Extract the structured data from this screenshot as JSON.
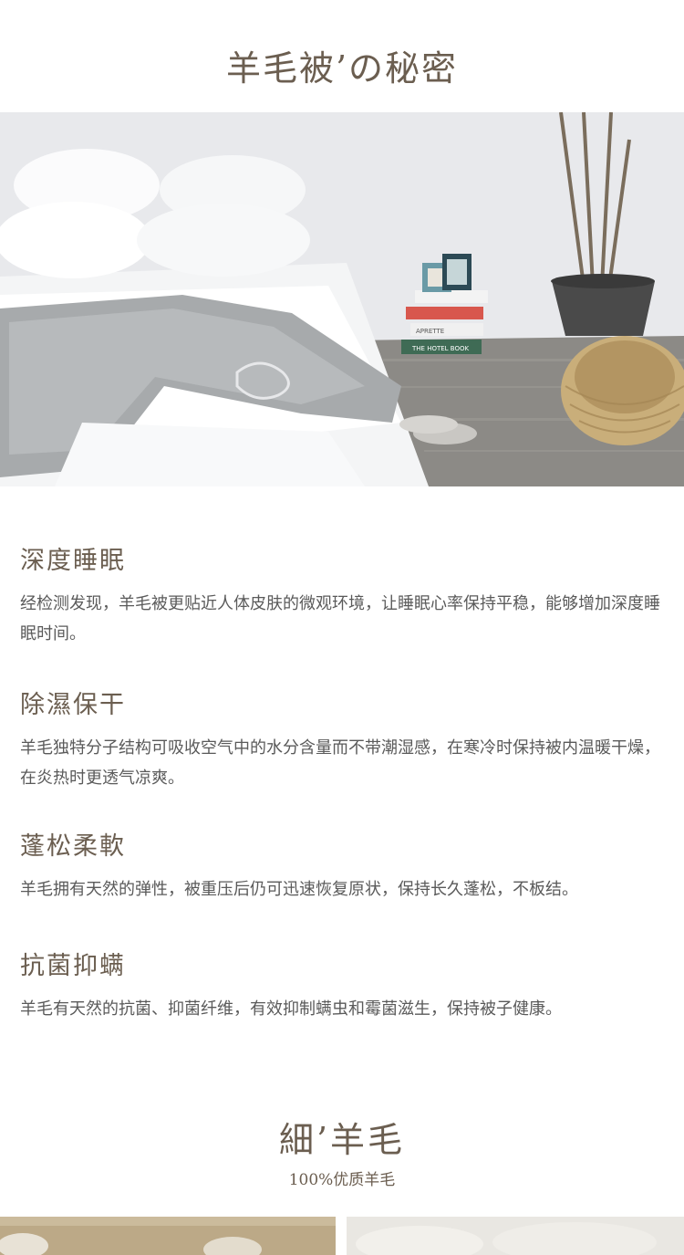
{
  "header": {
    "title": "羊毛被’の秘密"
  },
  "hero": {
    "book_spine_1": "THE HOTEL BOOK",
    "book_spine_2": "APRETTE"
  },
  "features": [
    {
      "heading": "深度睡眠",
      "text": "经检测发现，羊毛被更贴近人体皮肤的微观环境，让睡眠心率保持平稳，能够增加深度睡眠时间。"
    },
    {
      "heading": "除濕保干",
      "text": "羊毛独特分子结构可吸收空气中的水分含量而不带潮湿感，在寒冷时保持被内温暖干燥，在炎热时更透气凉爽。"
    },
    {
      "heading": "蓬松柔軟",
      "text": "羊毛拥有天然的弹性，被重压后仍可迅速恢复原状，保持长久蓬松，不板结。"
    },
    {
      "heading": "抗菌抑螨",
      "text": "羊毛有天然的抗菌、抑菌纤维，有效抑制螨虫和霉菌滋生，保持被子健康。"
    }
  ],
  "footer_section": {
    "title": "細’羊毛",
    "subtitle": "100%优质羊毛"
  },
  "colors": {
    "heading": "#6b5e50",
    "body_text": "#5a5a5a",
    "background": "#ffffff"
  }
}
